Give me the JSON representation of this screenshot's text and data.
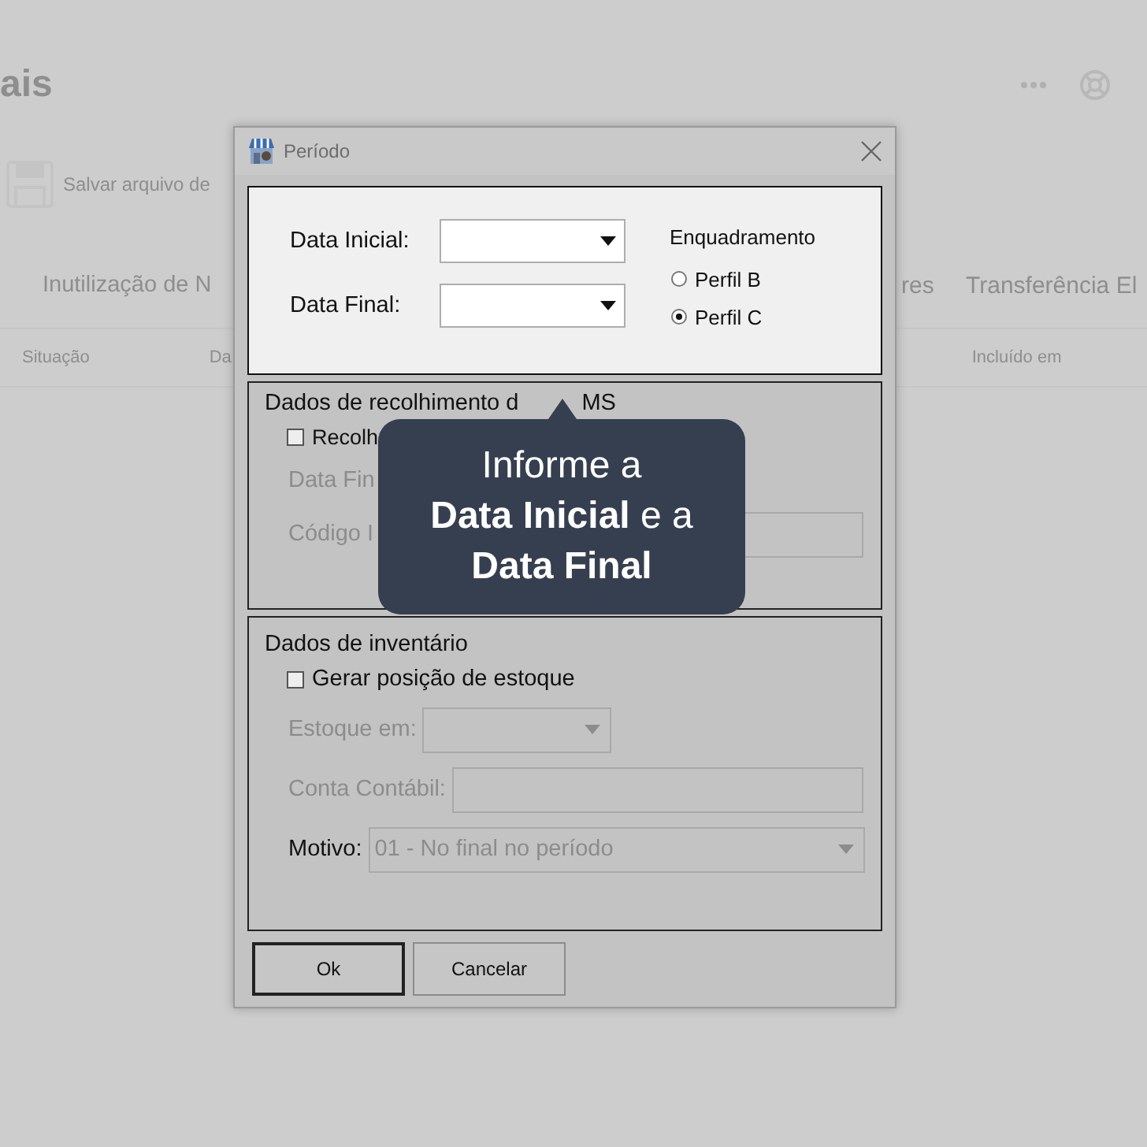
{
  "background": {
    "title": "ais",
    "action_text": "Salvar arquivo de",
    "tabs": [
      {
        "label": "Inutilização de N"
      },
      {
        "label": "res"
      },
      {
        "label": "Transferência El"
      }
    ],
    "columns": [
      "Situação",
      "Da",
      "Incluído em"
    ]
  },
  "dialog": {
    "title": "Período",
    "period": {
      "fields": [
        {
          "label": "Data Inicial:"
        },
        {
          "label": "Data Final:"
        }
      ],
      "profile": {
        "title": "Enquadramento",
        "options": [
          {
            "label": "Perfil B",
            "selected": false
          },
          {
            "label": "Perfil C",
            "selected": true
          }
        ]
      }
    },
    "icms": {
      "title": "Dados de recolhimento d",
      "title_tail": "MS",
      "checkbox": {
        "label": "Recolh",
        "checked": false
      },
      "rows": [
        {
          "kind": "label",
          "label": "Data Fin",
          "disabled": true
        },
        {
          "kind": "field",
          "label": "Código I",
          "disabled": true
        }
      ]
    },
    "inventory": {
      "title": "Dados de inventário",
      "checkbox": {
        "label": "Gerar posição de estoque",
        "checked": false
      },
      "rows": [
        {
          "kind": "combo",
          "label": "Estoque em:",
          "disabled": true
        },
        {
          "kind": "field",
          "label": "Conta Contábil:",
          "disabled": true
        },
        {
          "kind": "combo",
          "label": "Motivo:",
          "value": "01 - No final no período",
          "disabled": false
        }
      ]
    },
    "buttons": [
      {
        "label": "Ok",
        "default": true
      },
      {
        "label": "Cancelar",
        "default": false
      }
    ]
  },
  "tooltip": {
    "lines": [
      "Informe a",
      "**Data Inicial** e a",
      "**Data Final**"
    ]
  }
}
